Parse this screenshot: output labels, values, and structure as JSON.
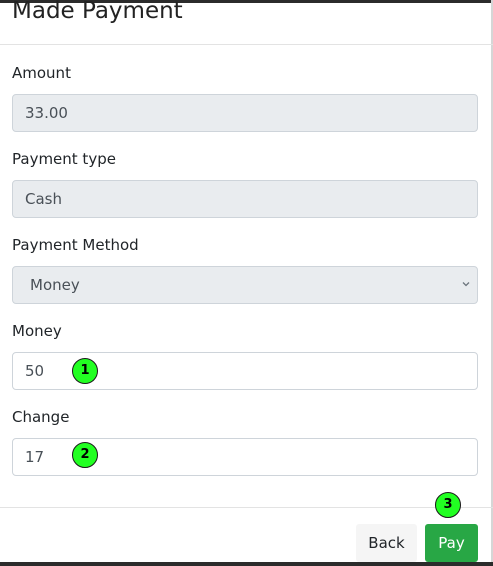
{
  "modal": {
    "title": "Made Payment"
  },
  "form": {
    "amount": {
      "label": "Amount",
      "value": "33.00"
    },
    "payment_type": {
      "label": "Payment type",
      "value": "Cash"
    },
    "payment_method": {
      "label": "Payment Method",
      "selected": "Money"
    },
    "money": {
      "label": "Money",
      "value": "50"
    },
    "change": {
      "label": "Change",
      "value": "17"
    }
  },
  "annotations": {
    "marker_1": "1",
    "marker_2": "2",
    "marker_3": "3",
    "color": "#22ff22"
  },
  "footer": {
    "back_label": "Back",
    "pay_label": "Pay"
  },
  "colors": {
    "pay_button": "#28a745",
    "readonly_field": "#e9ecef"
  }
}
